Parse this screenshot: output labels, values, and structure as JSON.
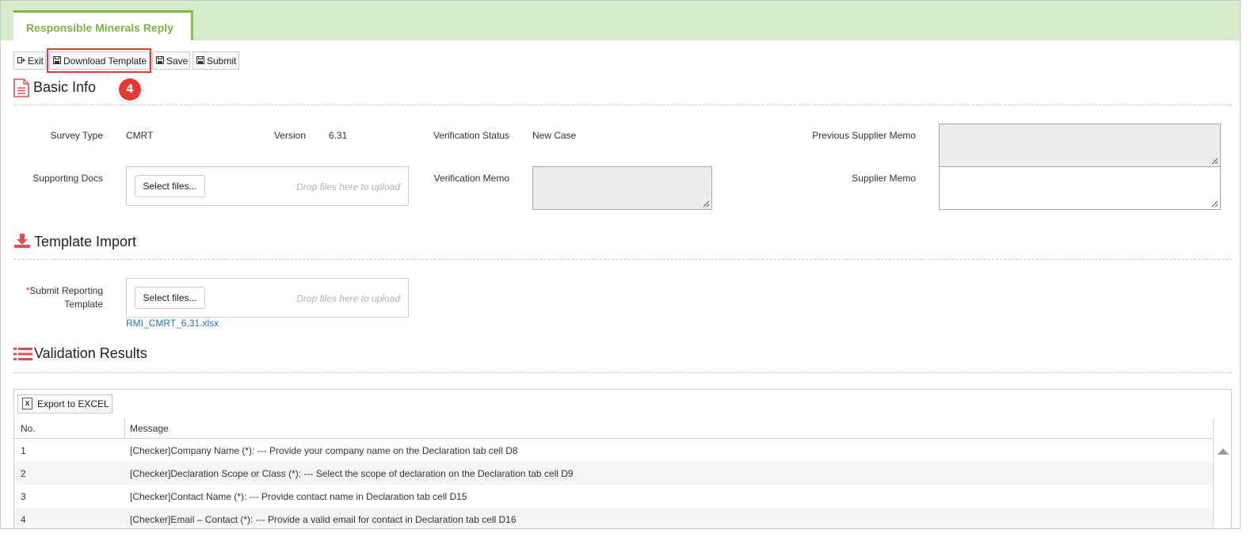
{
  "tab": {
    "label": "Responsible Minerals Reply"
  },
  "toolbar": {
    "exit": "Exit",
    "download_template": "Download Template",
    "save": "Save",
    "submit": "Submit"
  },
  "callout": {
    "step": "4"
  },
  "basic_info": {
    "title": "Basic Info",
    "survey_type_label": "Survey Type",
    "survey_type_value": "CMRT",
    "version_label": "Version",
    "version_value": "6.31",
    "verification_status_label": "Verification Status",
    "verification_status_value": "New Case",
    "previous_supplier_memo_label": "Previous Supplier Memo",
    "supporting_docs_label": "Supporting Docs",
    "verification_memo_label": "Verification Memo",
    "supplier_memo_label": "Supplier Memo",
    "select_files": "Select files...",
    "drop_hint": "Drop files here to upload"
  },
  "template_import": {
    "title": "Template Import",
    "required_mark": "*",
    "submit_label_line1": "Submit Reporting",
    "submit_label_line2": "Template",
    "select_files": "Select files...",
    "drop_hint": "Drop files here to upload",
    "uploaded_file": "RMI_CMRT_6.31.xlsx"
  },
  "validation": {
    "title": "Validation Results",
    "export_label": "Export to EXCEL",
    "col_no": "No.",
    "col_message": "Message",
    "rows": [
      {
        "no": "1",
        "message": "[Checker]Company Name (*): --- Provide your company name on the Declaration tab cell D8"
      },
      {
        "no": "2",
        "message": "[Checker]Declaration Scope or Class (*): --- Select the scope of declaration on the Declaration tab cell D9"
      },
      {
        "no": "3",
        "message": "[Checker]Contact Name (*): --- Provide contact name in Declaration tab cell D15"
      },
      {
        "no": "4",
        "message": "[Checker]Email – Contact (*): --- Provide a valid email for contact in Declaration tab cell D16"
      }
    ]
  },
  "colors": {
    "accent": "#7cb342",
    "header_bg": "#d6ebcb",
    "highlight": "#e53935",
    "link": "#2a6ebb",
    "icon_red": "#e05252"
  }
}
